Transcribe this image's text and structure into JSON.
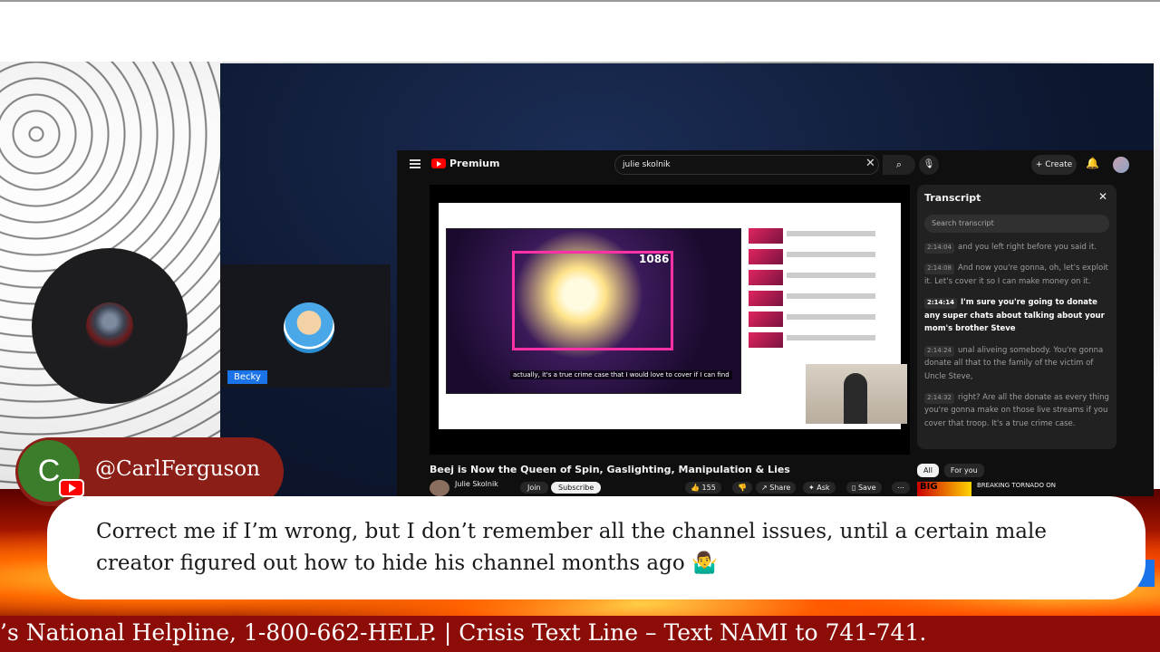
{
  "stream": {
    "participant_name": "Becky",
    "youtube": {
      "logo_text": "Premium",
      "search_value": "julie skolnik",
      "create_label": "Create",
      "inner_count": "1086",
      "inner_caption": "actually, it's a true crime case that I would love to cover if I can find",
      "video_title": "Beej is Now the Queen of Spin, Gaslighting, Manipulation & Lies",
      "channel_name": "Julie Skolnik",
      "join_label": "Join",
      "subscribe_label": "Subscribe",
      "like_count": "155",
      "share_label": "Share",
      "ask_label": "Ask",
      "save_label": "Save",
      "transcript": {
        "title": "Transcript",
        "search_placeholder": "Search transcript",
        "segments": [
          {
            "time": "2:14:04",
            "text": "and you left right before you said it."
          },
          {
            "time": "2:14:08",
            "text": "And now you're gonna, oh, let's exploit it. Let's cover it so I can make money on it."
          },
          {
            "time": "2:14:14",
            "text": "I'm sure you're going to donate any super chats about talking about your mom's brother Steve"
          },
          {
            "time": "2:14:24",
            "text": "unal aliveing somebody. You're gonna donate all that to the family of the victim of Uncle Steve,"
          },
          {
            "time": "2:14:32",
            "text": "right? Are all the donate as every thing you're gonna make on those live streams if you cover that troop. It's a true crime case."
          }
        ]
      },
      "chips": [
        "All",
        "For you"
      ],
      "rec_thumb_text": "BIG",
      "rec_title": "BREAKING TORNADO ON"
    }
  },
  "chat": {
    "avatar_letter": "C",
    "username": "@CarlFerguson",
    "message": "Correct me if I’m wrong, but I don’t remember all the channel issues, until a certain male creator figured out how to hide his channel months ago 🤷‍♂️"
  },
  "ticker": {
    "text": "’s National Helpline, 1-800-662-HELP. | Crisis Text Line – Text NAMI to 741-741."
  }
}
